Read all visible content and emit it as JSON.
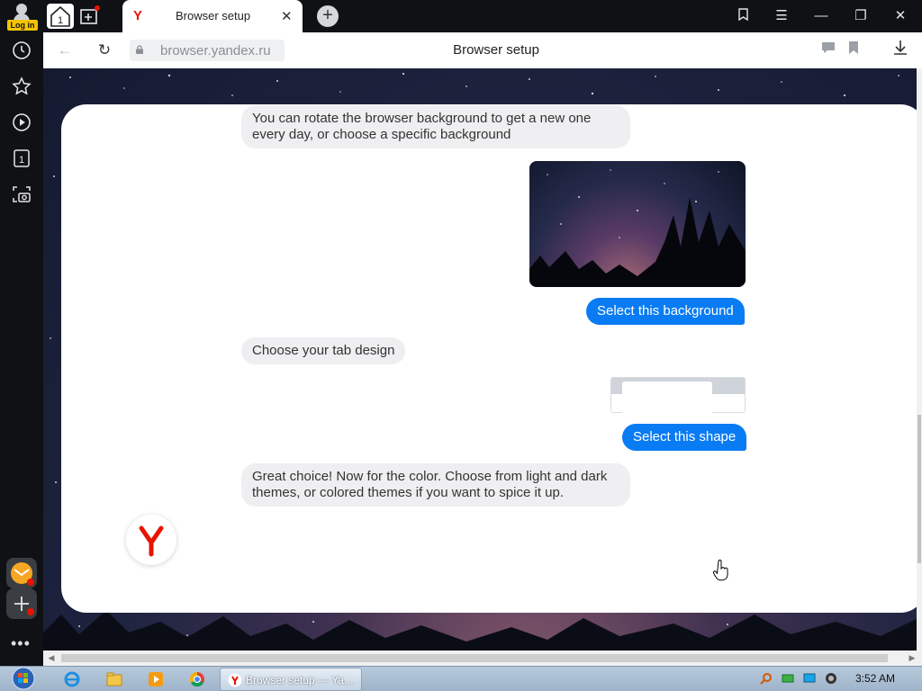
{
  "browser": {
    "login_label": "Log in",
    "home_tab_count": "1",
    "tab": {
      "title": "Browser setup"
    },
    "address": {
      "url": "browser.yandex.ru",
      "page_title": "Browser setup"
    }
  },
  "sidebar": {
    "tab_counter": "1"
  },
  "chat": {
    "msg_background": "You can rotate the browser background to get a new one every day, or choose a specific background",
    "btn_background": "Select this background",
    "msg_tab_design": "Choose your tab design",
    "btn_shape": "Select this shape",
    "msg_color": "Great choice! Now for the color. Choose from light and dark themes, or colored themes if you want to spice it up."
  },
  "taskbar": {
    "active_task": "Browser setup — Ya...",
    "clock": "3:52 AM"
  },
  "colors": {
    "accent_blue": "#0a7cf3",
    "yandex_red": "#e61400"
  }
}
